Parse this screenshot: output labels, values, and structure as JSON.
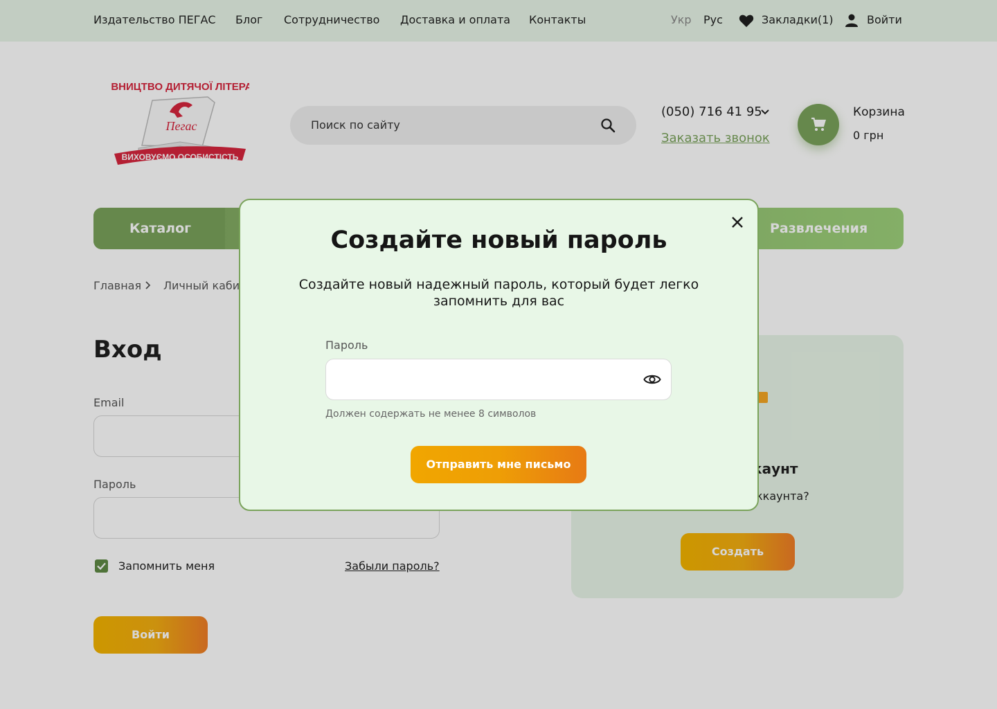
{
  "top_nav": {
    "items": [
      "Издательство ПЕГАС",
      "Блог",
      "Сотрудничество",
      "Доставка и оплата",
      "Контакты"
    ],
    "lang_ukr": "Укр",
    "lang_rus": "Рус",
    "bookmarks": "Закладки(1)",
    "login": "Войти"
  },
  "logo": {
    "top_text": "ВИДАВНИЦТВО ДИТЯЧОЇ ЛІТЕРАТУРИ",
    "name": "Пегас",
    "ribbon_text": "ВИХОВУЄМО ОСОБИСТІСТЬ"
  },
  "header": {
    "search_placeholder": "Поиск по сайту",
    "phone": "(050) 716 41 95",
    "callback": "Заказать звонок",
    "cart_label": "Корзина",
    "cart_total": "0 грн"
  },
  "menu": {
    "catalog": "Каталог",
    "entertainment": "Развлечения"
  },
  "breadcrumbs": {
    "home": "Главная",
    "current": "Личный каби"
  },
  "login_form": {
    "title": "Вход",
    "email_label": "Email",
    "password_label": "Пароль",
    "remember": "Запомнить меня",
    "forgot": "Забыли пароль?",
    "submit": "Войти"
  },
  "register_card": {
    "title": "каунт",
    "question": "ккаунта?",
    "button": "Создать"
  },
  "modal": {
    "title": "Создайте новый пароль",
    "subtitle": "Создайте новый надежный пароль, который будет легко запомнить для вас",
    "password_label": "Пароль",
    "password_value": "",
    "hint": "Должен содержать не менее 8 символов",
    "submit": "Отправить мне письмо"
  },
  "colors": {
    "accent_green": "#7aa35b",
    "topbar_bg": "#e8f5e7",
    "modal_bg": "#e8f7e7",
    "button_orange_start": "#f1a600",
    "button_orange_end": "#e77a14",
    "logo_red": "#d7263d"
  }
}
